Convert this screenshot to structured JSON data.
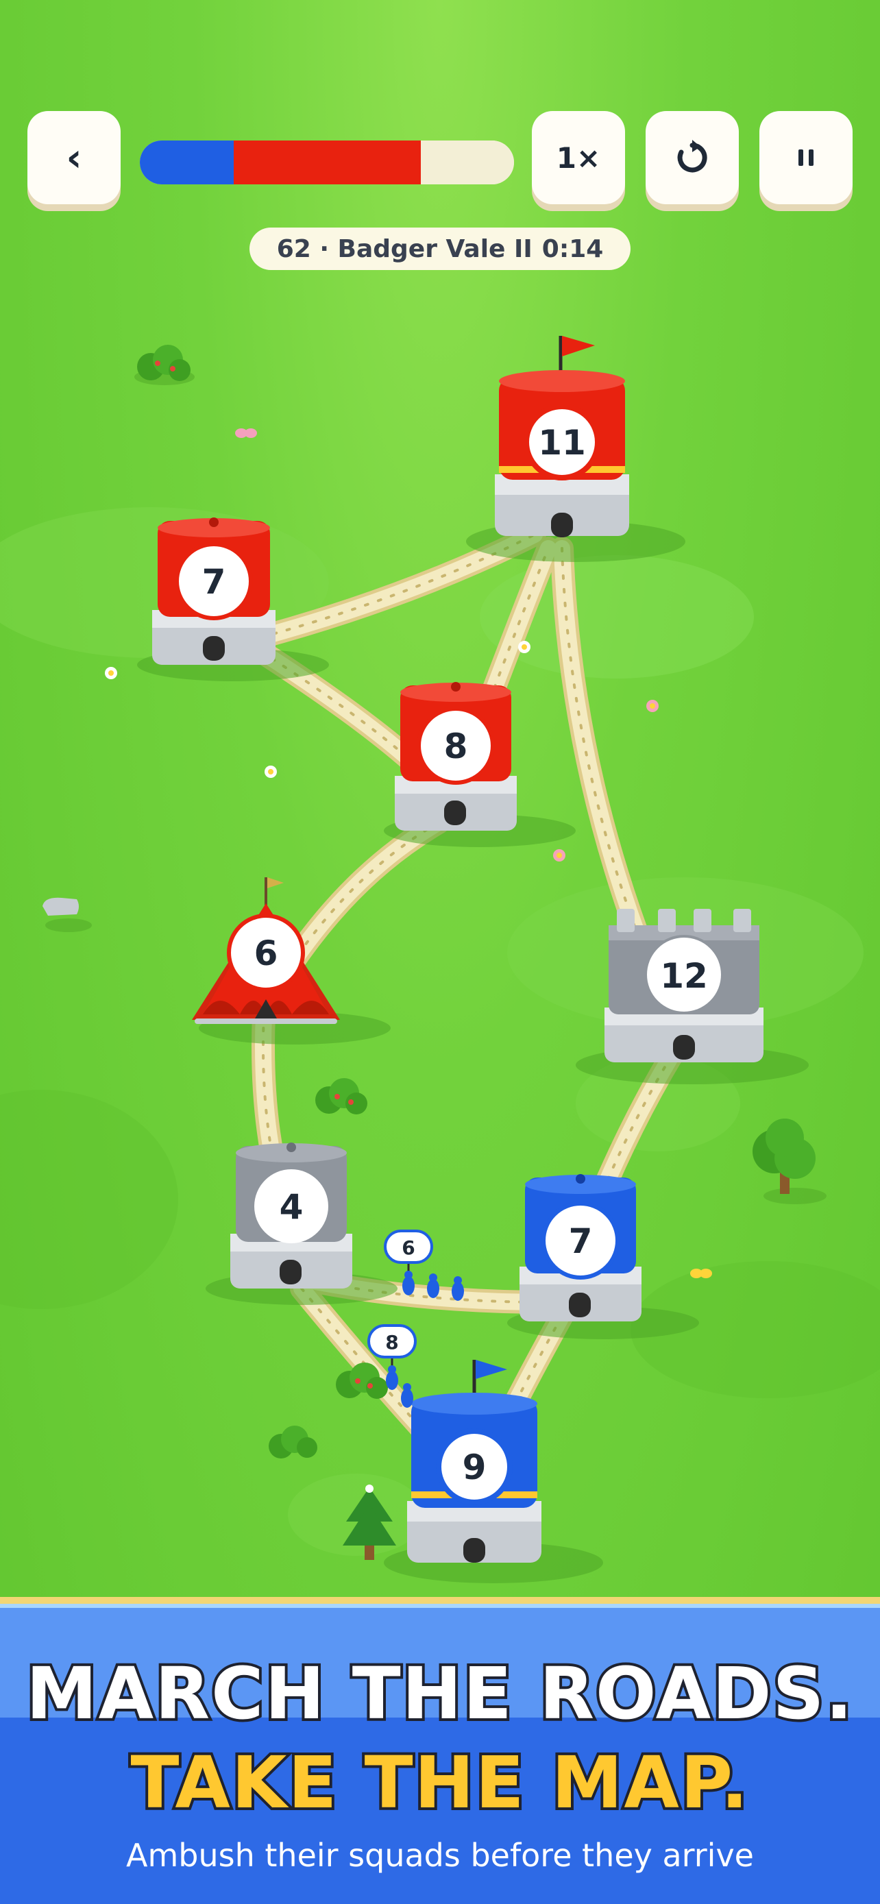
{
  "hud": {
    "back_label": "‹",
    "speed_label": "1×",
    "restart_icon": "restart-icon",
    "pause_icon": "pause-icon",
    "territory_share": {
      "blue": 0.25,
      "red": 0.5,
      "neutral": 0.25
    },
    "level_number": "62 · Badger Vale II",
    "timer": "0:14"
  },
  "colors": {
    "blue": "#1f5fe3",
    "red": "#e8220f",
    "neutral": "#a8adb5",
    "grass": "#6bcc36",
    "road": "#f2e8b8"
  },
  "towers": [
    {
      "id": "t11",
      "owner": "red",
      "type": "castle-flag",
      "count": "11"
    },
    {
      "id": "t7r",
      "owner": "red",
      "type": "drum",
      "count": "7"
    },
    {
      "id": "t8",
      "owner": "red",
      "type": "drum",
      "count": "8"
    },
    {
      "id": "t6",
      "owner": "red",
      "type": "tent",
      "count": "6"
    },
    {
      "id": "t12",
      "owner": "neutral",
      "type": "fort",
      "count": "12"
    },
    {
      "id": "t4",
      "owner": "neutral",
      "type": "drum",
      "count": "4"
    },
    {
      "id": "t7b",
      "owner": "blue",
      "type": "drum",
      "count": "7"
    },
    {
      "id": "t9",
      "owner": "blue",
      "type": "castle-flag",
      "count": "9"
    }
  ],
  "squads": [
    {
      "owner": "blue",
      "count": "6"
    },
    {
      "owner": "blue",
      "count": "8"
    }
  ],
  "banner": {
    "line1": "MARCH THE ROADS.",
    "line2": "TAKE THE MAP.",
    "subtitle": "Ambush their squads before they arrive"
  }
}
